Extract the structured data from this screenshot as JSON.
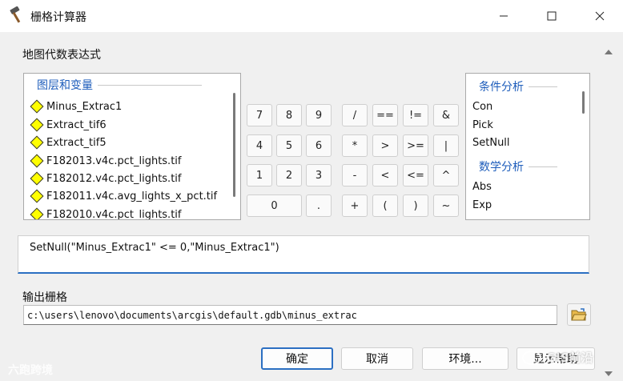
{
  "window": {
    "title": "栅格计算器"
  },
  "expression_section": {
    "label": "地图代数表达式"
  },
  "layers": {
    "header": "图层和变量",
    "items": [
      "Minus_Extrac1",
      "Extract_tif6",
      "Extract_tif5",
      "F182013.v4c.pct_lights.tif",
      "F182012.v4c.pct_lights.tif",
      "F182011.v4c.avg_lights_x_pct.tif",
      "F182010.v4c.pct_lights.tif"
    ]
  },
  "calculator": {
    "row1": [
      "7",
      "8",
      "9",
      "/",
      "==",
      "!=",
      "&"
    ],
    "row2": [
      "4",
      "5",
      "6",
      "*",
      ">",
      ">=",
      "|"
    ],
    "row3": [
      "1",
      "2",
      "3",
      "-",
      "<",
      "<=",
      "^"
    ],
    "row4": [
      "0",
      ".",
      "+",
      "(",
      ")",
      "~"
    ]
  },
  "functions": {
    "groups": [
      {
        "header": "条件分析",
        "items": [
          "Con",
          "Pick",
          "SetNull"
        ]
      },
      {
        "header": "数学分析",
        "items": [
          "Abs",
          "Exp"
        ]
      }
    ]
  },
  "expression": {
    "value": "SetNull(\"Minus_Extrac1\" <= 0,\"Minus_Extrac1\")"
  },
  "output": {
    "label": "输出栅格",
    "value": "c:\\users\\lenovo\\documents\\arcgis\\default.gdb\\minus_extrac"
  },
  "buttons": {
    "ok": "确定",
    "cancel": "取消",
    "environments": "环境...",
    "help": "显示帮助"
  },
  "watermarks": {
    "left": "六跑跨境",
    "right": "GIS前沿"
  }
}
